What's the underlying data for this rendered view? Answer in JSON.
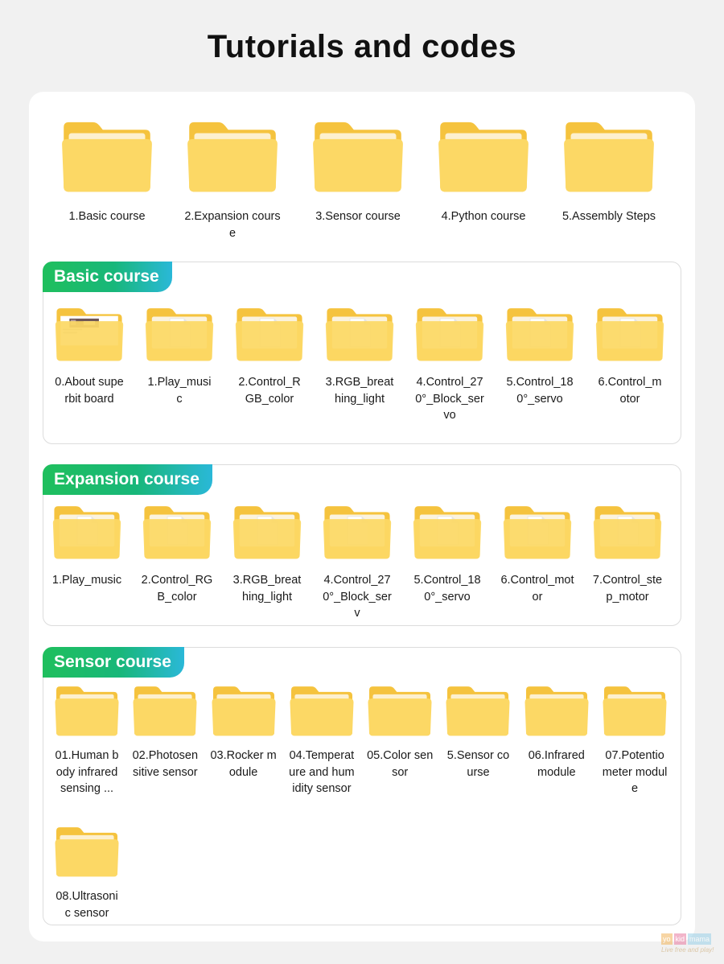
{
  "title": "Tutorials and codes",
  "top_folders": [
    {
      "label": "1.Basic course"
    },
    {
      "label": "2.Expansion course"
    },
    {
      "label": "3.Sensor course"
    },
    {
      "label": "4.Python course"
    },
    {
      "label": "5.Assembly Steps"
    }
  ],
  "sections": [
    {
      "title": "Basic course",
      "items": [
        {
          "label": "0.About superbit board",
          "thumb": "photo"
        },
        {
          "label": "1.Play_music",
          "thumb": "doc"
        },
        {
          "label": "2.Control_RGB_color",
          "thumb": "doc"
        },
        {
          "label": "3.RGB_breathing_light",
          "thumb": "doc"
        },
        {
          "label": "4.Control_270°_Block_servo",
          "thumb": "doc"
        },
        {
          "label": "5.Control_180°_servo",
          "thumb": "doc"
        },
        {
          "label": "6.Control_motor",
          "thumb": "doc"
        }
      ]
    },
    {
      "title": "Expansion course",
      "items": [
        {
          "label": "1.Play_music",
          "thumb": "doc"
        },
        {
          "label": "2.Control_RGB_color",
          "thumb": "doc"
        },
        {
          "label": "3.RGB_breathing_light",
          "thumb": "doc"
        },
        {
          "label": "4.Control_270°_Block_serv",
          "thumb": "doc"
        },
        {
          "label": "5.Control_180°_servo",
          "thumb": "doc"
        },
        {
          "label": "6.Control_motor",
          "thumb": "doc"
        },
        {
          "label": "7.Control_step_motor",
          "thumb": "doc"
        }
      ]
    },
    {
      "title": "Sensor course",
      "items": [
        {
          "label": "01.Human body infrared sensing ...",
          "thumb": "plain"
        },
        {
          "label": "02.Photosensitive sensor",
          "thumb": "plain"
        },
        {
          "label": "03.Rocker module",
          "thumb": "plain"
        },
        {
          "label": "04.Temperature and humidity sensor",
          "thumb": "plain"
        },
        {
          "label": "05.Color sensor",
          "thumb": "plain"
        },
        {
          "label": "5.Sensor course",
          "thumb": "plain"
        },
        {
          "label": "06.Infrared module",
          "thumb": "plain"
        },
        {
          "label": "07.Potentiometer module",
          "thumb": "plain"
        },
        {
          "label": "08.Ultrasonic sensor",
          "thumb": "plain"
        }
      ]
    }
  ],
  "colors": {
    "folder_back": "#f5c33e",
    "folder_front": "#fcd865",
    "tag_start": "#1fbf5d",
    "tag_end": "#2ab8d8"
  }
}
